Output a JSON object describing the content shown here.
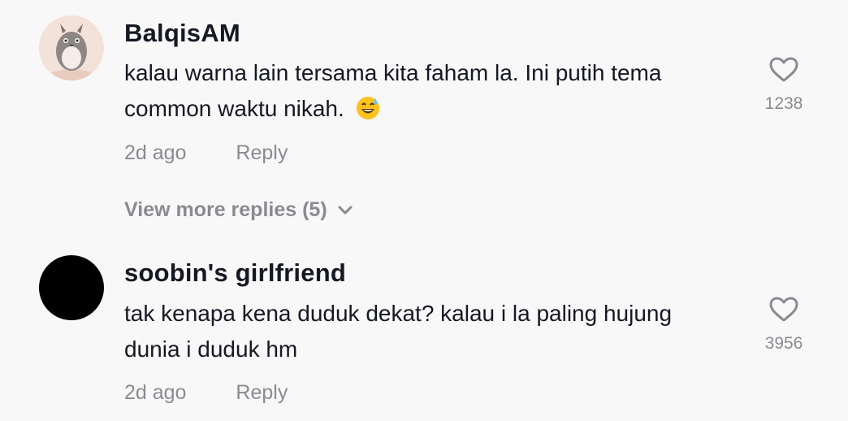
{
  "comments": [
    {
      "username": "BalqisAM",
      "text": "kalau warna lain tersama kita faham la. Ini putih tema common waktu nikah.",
      "emoji": "😅",
      "time": "2d ago",
      "reply_label": "Reply",
      "likes": "1238",
      "avatar": "totoro-avatar"
    },
    {
      "username": "soobin's girlfriend",
      "text": "tak kenapa kena duduk dekat? kalau i la paling hujung dunia i duduk hm",
      "time": "2d ago",
      "reply_label": "Reply",
      "likes": "3956",
      "avatar": "black-avatar"
    }
  ],
  "view_more": "View more replies (5)",
  "colors": {
    "background": "#f8f8f8",
    "text": "#161823",
    "muted": "#8a8b91"
  }
}
